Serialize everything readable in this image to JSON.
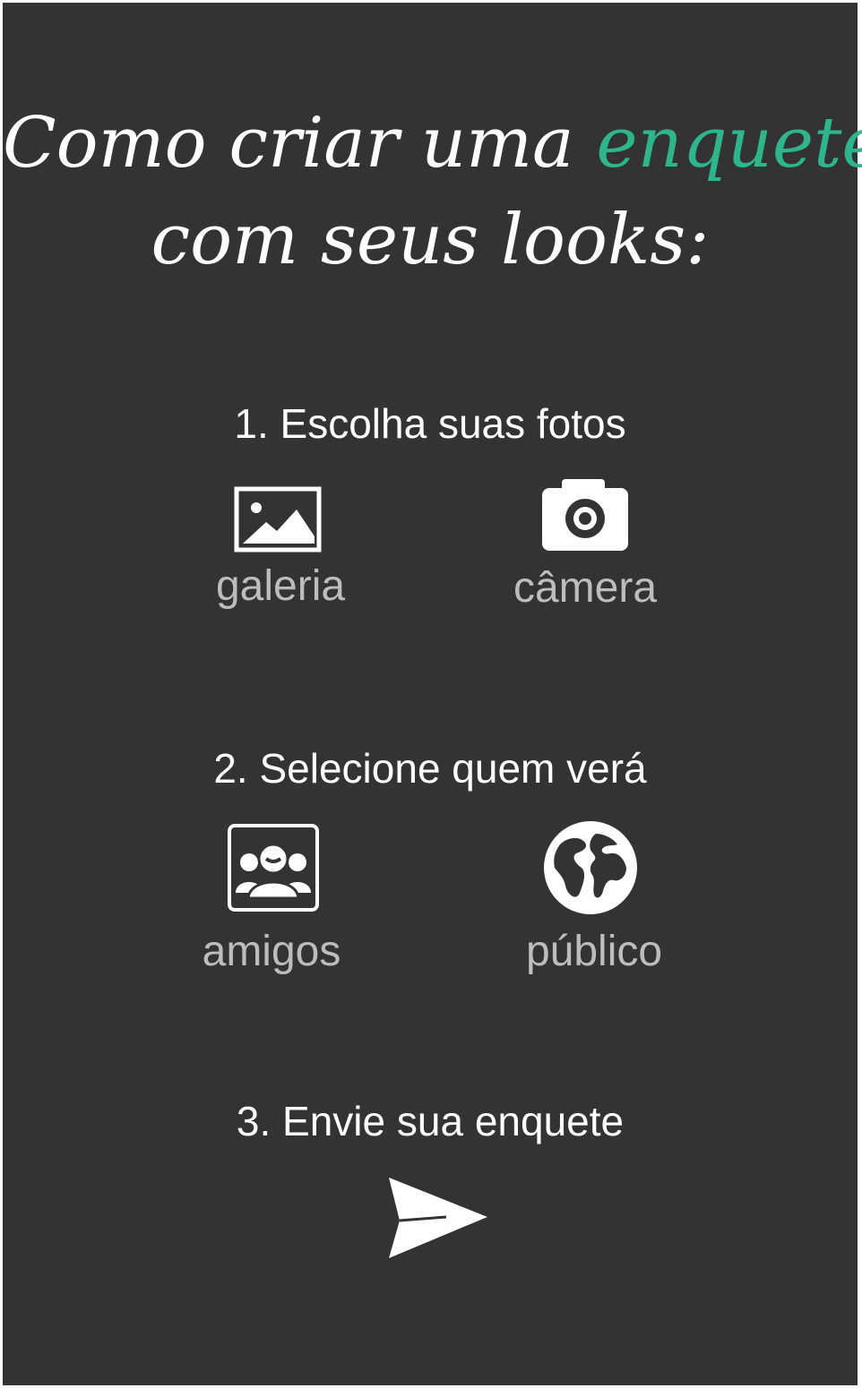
{
  "header": {
    "title_line1_prefix": "Como criar uma ",
    "title_line1_accent": "enquete",
    "title_line2": "com seus looks:",
    "accent_color": "#2fb58a",
    "background_color": "#333333"
  },
  "steps": [
    {
      "label": "1. Escolha suas fotos",
      "options": [
        {
          "label": "galeria",
          "icon": "image-icon"
        },
        {
          "label": "câmera",
          "icon": "camera-icon"
        }
      ]
    },
    {
      "label": "2. Selecione quem verá",
      "options": [
        {
          "label": "amigos",
          "icon": "group-icon"
        },
        {
          "label": "público",
          "icon": "globe-icon"
        }
      ]
    },
    {
      "label": "3. Envie sua enquete",
      "options": [
        {
          "icon": "send-icon"
        }
      ]
    }
  ]
}
